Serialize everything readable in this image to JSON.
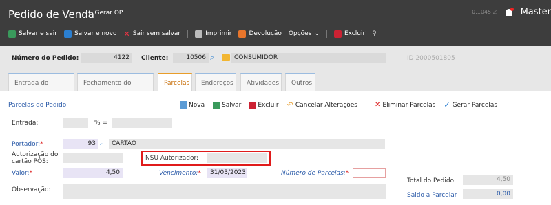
{
  "app": {
    "title": "Pedido de Venda",
    "gerar_op": "Gerar OP",
    "session_id": "0.1045 ℤ",
    "user": "Master"
  },
  "toolbar": {
    "salvar_sair": "Salvar e sair",
    "salvar_novo": "Salvar e novo",
    "sair_sem_salvar": "Sair sem salvar",
    "imprimir": "Imprimir",
    "devolucao": "Devolução",
    "opcoes": "Opções",
    "excluir": "Excluir"
  },
  "header": {
    "numero_label": "Número do Pedido:",
    "numero_value": "4122",
    "cliente_label": "Cliente:",
    "cliente_code": "10506",
    "cliente_name": "CONSUMIDOR",
    "id_text": "ID 2000501805"
  },
  "tabs": [
    {
      "label": "Entrada do Pedido"
    },
    {
      "label": "Fechamento do Pedido"
    },
    {
      "label": "Parcelas"
    },
    {
      "label": "Endereços"
    },
    {
      "label": "Atividades"
    },
    {
      "label": "Outros"
    }
  ],
  "parcelas": {
    "section_title": "Parcelas do Pedido",
    "actions": {
      "nova": "Nova",
      "salvar": "Salvar",
      "excluir": "Excluir",
      "cancelar": "Cancelar Alterações",
      "eliminar": "Eliminar Parcelas",
      "gerar": "Gerar Parcelas"
    },
    "entrada_label": "Entrada:",
    "percent_label": "% =",
    "portador_label": "Portador:",
    "portador_code": "93",
    "portador_name": "CARTAO",
    "autorizacao_label_1": "Autorização do",
    "autorizacao_label_2": "cartão POS:",
    "nsu_label": "NSU Autorizador:",
    "valor_label": "Valor:",
    "valor_value": "4,50",
    "vencimento_label": "Vencimento:",
    "vencimento_value": "31/03/2023",
    "num_parcelas_label": "Número de Parcelas:",
    "observacao_label": "Observação:"
  },
  "totais": {
    "total_label": "Total do Pedido",
    "total_value": "4,50",
    "saldo_label": "Saldo a Parcelar",
    "saldo_value": "0,00"
  },
  "colors": {
    "topbar": "#3d3d3d",
    "accent_blue": "#2a5aa8",
    "highlight_red": "#e01b1b",
    "active_tab": "#c66a00"
  }
}
